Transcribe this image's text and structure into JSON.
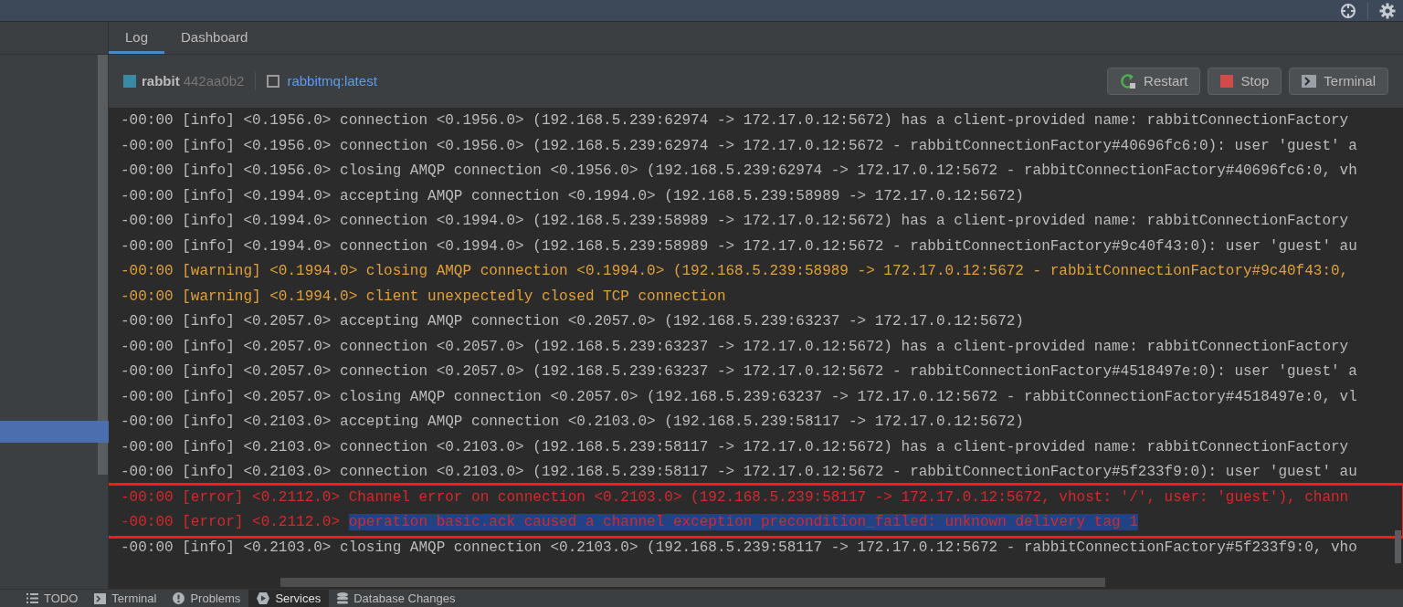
{
  "tabs": [
    {
      "label": "Log",
      "selected": true
    },
    {
      "label": "Dashboard",
      "selected": false
    }
  ],
  "sidebar": {
    "has_selection": true
  },
  "container": {
    "name": "rabbit",
    "id": "442aa0b2",
    "image": "rabbitmq:latest"
  },
  "buttons": [
    {
      "kind": "restart",
      "label": "Restart"
    },
    {
      "kind": "stop",
      "label": "Stop"
    },
    {
      "kind": "terminal",
      "label": "Terminal"
    }
  ],
  "log": [
    {
      "kind": "info",
      "highlighted": false,
      "text": "-00:00 [info] <0.1956.0> connection <0.1956.0> (192.168.5.239:62974 -> 172.17.0.12:5672) has a client-provided name: rabbitConnectionFactory"
    },
    {
      "kind": "info",
      "highlighted": false,
      "text": "-00:00 [info] <0.1956.0> connection <0.1956.0> (192.168.5.239:62974 -> 172.17.0.12:5672 - rabbitConnectionFactory#40696fc6:0): user 'guest' a"
    },
    {
      "kind": "info",
      "highlighted": false,
      "text": "-00:00 [info] <0.1956.0> closing AMQP connection <0.1956.0> (192.168.5.239:62974 -> 172.17.0.12:5672 - rabbitConnectionFactory#40696fc6:0, vh"
    },
    {
      "kind": "info",
      "highlighted": false,
      "text": "-00:00 [info] <0.1994.0> accepting AMQP connection <0.1994.0> (192.168.5.239:58989 -> 172.17.0.12:5672)"
    },
    {
      "kind": "info",
      "highlighted": false,
      "text": "-00:00 [info] <0.1994.0> connection <0.1994.0> (192.168.5.239:58989 -> 172.17.0.12:5672) has a client-provided name: rabbitConnectionFactory"
    },
    {
      "kind": "info",
      "highlighted": false,
      "text": "-00:00 [info] <0.1994.0> connection <0.1994.0> (192.168.5.239:58989 -> 172.17.0.12:5672 - rabbitConnectionFactory#9c40f43:0): user 'guest' au"
    },
    {
      "kind": "warning",
      "highlighted": false,
      "text": "-00:00 [warning] <0.1994.0> closing AMQP connection <0.1994.0> (192.168.5.239:58989 -> 172.17.0.12:5672 - rabbitConnectionFactory#9c40f43:0,"
    },
    {
      "kind": "warning",
      "highlighted": false,
      "text": "-00:00 [warning] <0.1994.0> client unexpectedly closed TCP connection"
    },
    {
      "kind": "info",
      "highlighted": false,
      "text": "-00:00 [info] <0.2057.0> accepting AMQP connection <0.2057.0> (192.168.5.239:63237 -> 172.17.0.12:5672)"
    },
    {
      "kind": "info",
      "highlighted": false,
      "text": "-00:00 [info] <0.2057.0> connection <0.2057.0> (192.168.5.239:63237 -> 172.17.0.12:5672) has a client-provided name: rabbitConnectionFactory"
    },
    {
      "kind": "info",
      "highlighted": false,
      "text": "-00:00 [info] <0.2057.0> connection <0.2057.0> (192.168.5.239:63237 -> 172.17.0.12:5672 - rabbitConnectionFactory#4518497e:0): user 'guest' a"
    },
    {
      "kind": "info",
      "highlighted": false,
      "text": "-00:00 [info] <0.2057.0> closing AMQP connection <0.2057.0> (192.168.5.239:63237 -> 172.17.0.12:5672 - rabbitConnectionFactory#4518497e:0, vl"
    },
    {
      "kind": "info",
      "highlighted": false,
      "text": "-00:00 [info] <0.2103.0> accepting AMQP connection <0.2103.0> (192.168.5.239:58117 -> 172.17.0.12:5672)"
    },
    {
      "kind": "info",
      "highlighted": false,
      "text": "-00:00 [info] <0.2103.0> connection <0.2103.0> (192.168.5.239:58117 -> 172.17.0.12:5672) has a client-provided name: rabbitConnectionFactory"
    },
    {
      "kind": "info",
      "highlighted": false,
      "text": "-00:00 [info] <0.2103.0> connection <0.2103.0> (192.168.5.239:58117 -> 172.17.0.12:5672 - rabbitConnectionFactory#5f233f9:0): user 'guest' au"
    },
    {
      "kind": "error",
      "highlighted": true,
      "text": "-00:00 [error] <0.2112.0> Channel error on connection <0.2103.0> (192.168.5.239:58117 -> 172.17.0.12:5672, vhost: '/', user: 'guest'), chann"
    },
    {
      "kind": "error",
      "highlighted": true,
      "text": "-00:00 [error] <0.2112.0>",
      "selection": "operation basic.ack caused a channel exception precondition_failed: unknown delivery tag 1"
    },
    {
      "kind": "info",
      "highlighted": false,
      "text": "-00:00 [info] <0.2103.0> closing AMQP connection <0.2103.0> (192.168.5.239:58117 -> 172.17.0.12:5672 - rabbitConnectionFactory#5f233f9:0, vho"
    }
  ],
  "tool_windows": [
    {
      "kind": "todo",
      "label": "TODO",
      "selected": false
    },
    {
      "kind": "terminal",
      "label": "Terminal",
      "selected": false
    },
    {
      "kind": "problems",
      "label": "Problems",
      "selected": false
    },
    {
      "kind": "services",
      "label": "Services",
      "selected": true
    },
    {
      "kind": "database",
      "label": "Database Changes",
      "selected": false
    }
  ]
}
